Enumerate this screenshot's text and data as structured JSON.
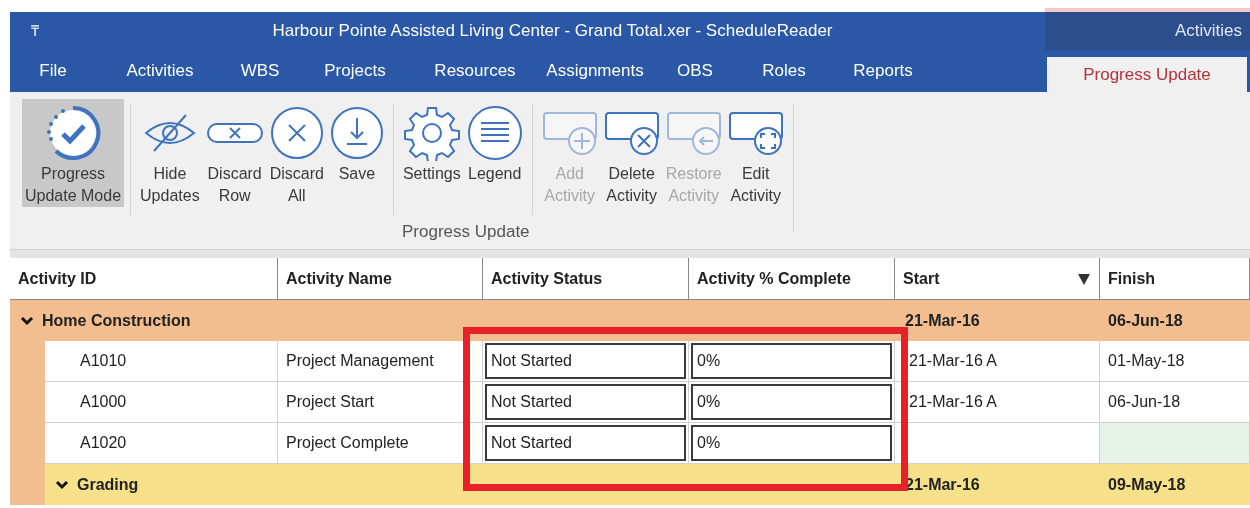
{
  "window": {
    "title": "Harbour Pointe Assisted Living Center - Grand Total.xer - ScheduleReader",
    "quick_access": "₸",
    "context_title": "Activities"
  },
  "menu": [
    {
      "label": "File",
      "selected": false
    },
    {
      "label": "Activities",
      "selected": false
    },
    {
      "label": "WBS",
      "selected": false
    },
    {
      "label": "Projects",
      "selected": false
    },
    {
      "label": "Resources",
      "selected": false
    },
    {
      "label": "Assignments",
      "selected": false
    },
    {
      "label": "OBS",
      "selected": false
    },
    {
      "label": "Roles",
      "selected": false
    },
    {
      "label": "Reports",
      "selected": false
    },
    {
      "label": "Progress Update",
      "selected": true
    }
  ],
  "ribbon": {
    "group_label": "Progress Update",
    "sections": [
      [
        {
          "label": "Progress Update Mode",
          "selected": true,
          "disabled": false
        }
      ],
      [
        {
          "label": "Hide Updates",
          "selected": false,
          "disabled": false
        },
        {
          "label": "Discard Row",
          "selected": false,
          "disabled": false
        },
        {
          "label": "Discard All",
          "selected": false,
          "disabled": false
        },
        {
          "label": "Save",
          "selected": false,
          "disabled": false
        }
      ],
      [
        {
          "label": "Settings",
          "selected": false,
          "disabled": false
        },
        {
          "label": "Legend",
          "selected": false,
          "disabled": false
        }
      ],
      [
        {
          "label": "Add Activity",
          "selected": false,
          "disabled": true
        },
        {
          "label": "Delete Activity",
          "selected": false,
          "disabled": false
        },
        {
          "label": "Restore Activity",
          "selected": false,
          "disabled": true
        },
        {
          "label": "Edit Activity",
          "selected": false,
          "disabled": false
        }
      ]
    ]
  },
  "table": {
    "columns": [
      {
        "label": "Activity ID",
        "sorted": false
      },
      {
        "label": "Activity Name",
        "sorted": false
      },
      {
        "label": "Activity Status",
        "sorted": false
      },
      {
        "label": "Activity % Complete",
        "sorted": false
      },
      {
        "label": "Start",
        "sorted": true
      },
      {
        "label": "Finish",
        "sorted": false
      }
    ],
    "rows": [
      {
        "kind": "group",
        "name": "Home Construction",
        "expanded": true,
        "start": "21-Mar-16",
        "finish": "06-Jun-18",
        "children": [
          {
            "kind": "activity",
            "id": "A1010",
            "name": "Project Management",
            "status": "Not Started",
            "percent": "0%",
            "start": "21-Mar-16 A",
            "finish": "01-May-18",
            "highlighted": false
          },
          {
            "kind": "activity",
            "id": "A1000",
            "name": "Project Start",
            "status": "Not Started",
            "percent": "0%",
            "start": "21-Mar-16 A",
            "finish": "06-Jun-18",
            "highlighted": false
          },
          {
            "kind": "activity",
            "id": "A1020",
            "name": "Project Complete",
            "status": "Not Started",
            "percent": "0%",
            "highlighted": true
          },
          {
            "kind": "group",
            "name": "Grading",
            "expanded": true,
            "start": "21-Mar-16",
            "finish": "09-May-18"
          }
        ]
      }
    ]
  },
  "annotation": {
    "kind": "highlight-box"
  }
}
